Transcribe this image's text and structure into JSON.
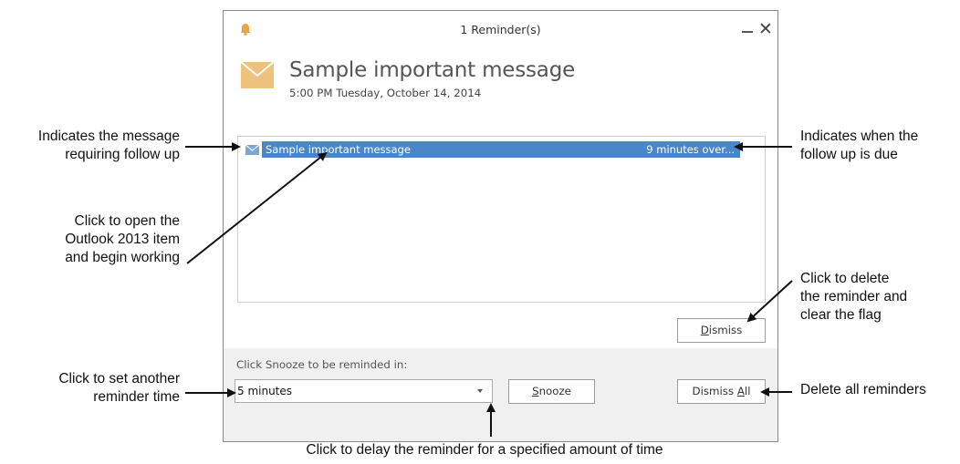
{
  "window": {
    "title": "1 Reminder(s)",
    "minimize_icon": "minimize-icon",
    "close_glyph": "✕",
    "bell_color": "#e8a44a"
  },
  "header": {
    "subject": "Sample important message",
    "due_date": "5:00 PM Tuesday, October 14, 2014",
    "icon": "envelope-icon",
    "icon_color": "#efc17e"
  },
  "reminders": [
    {
      "subject": "Sample important message",
      "due": "9 minutes over...",
      "selected": true,
      "icon": "envelope-icon"
    }
  ],
  "buttons": {
    "dismiss": {
      "accel": "D",
      "rest": "ismiss"
    },
    "snooze": {
      "accel": "S",
      "rest": "nooze"
    },
    "dismiss_all": {
      "pre": "Dismiss ",
      "accel": "A",
      "rest": "ll"
    }
  },
  "snooze": {
    "label": "Click Snooze to be reminded in:",
    "selected_value": "5 minutes"
  },
  "selection_color": "#4a87c8",
  "callouts": {
    "message_indicator": [
      "Indicates the message",
      "requiring follow up"
    ],
    "open_item": [
      "Click to open the",
      "Outlook 2013 item",
      "and begin working"
    ],
    "set_time": [
      "Click to set another",
      "reminder time"
    ],
    "due_indicator": [
      "Indicates when the",
      "follow up is due"
    ],
    "delete_reminder": [
      "Click to delete",
      "the reminder and",
      "clear the flag"
    ],
    "delete_all": [
      "Delete all reminders"
    ],
    "delay": [
      "Click to delay the reminder for a specified amount of time"
    ]
  }
}
